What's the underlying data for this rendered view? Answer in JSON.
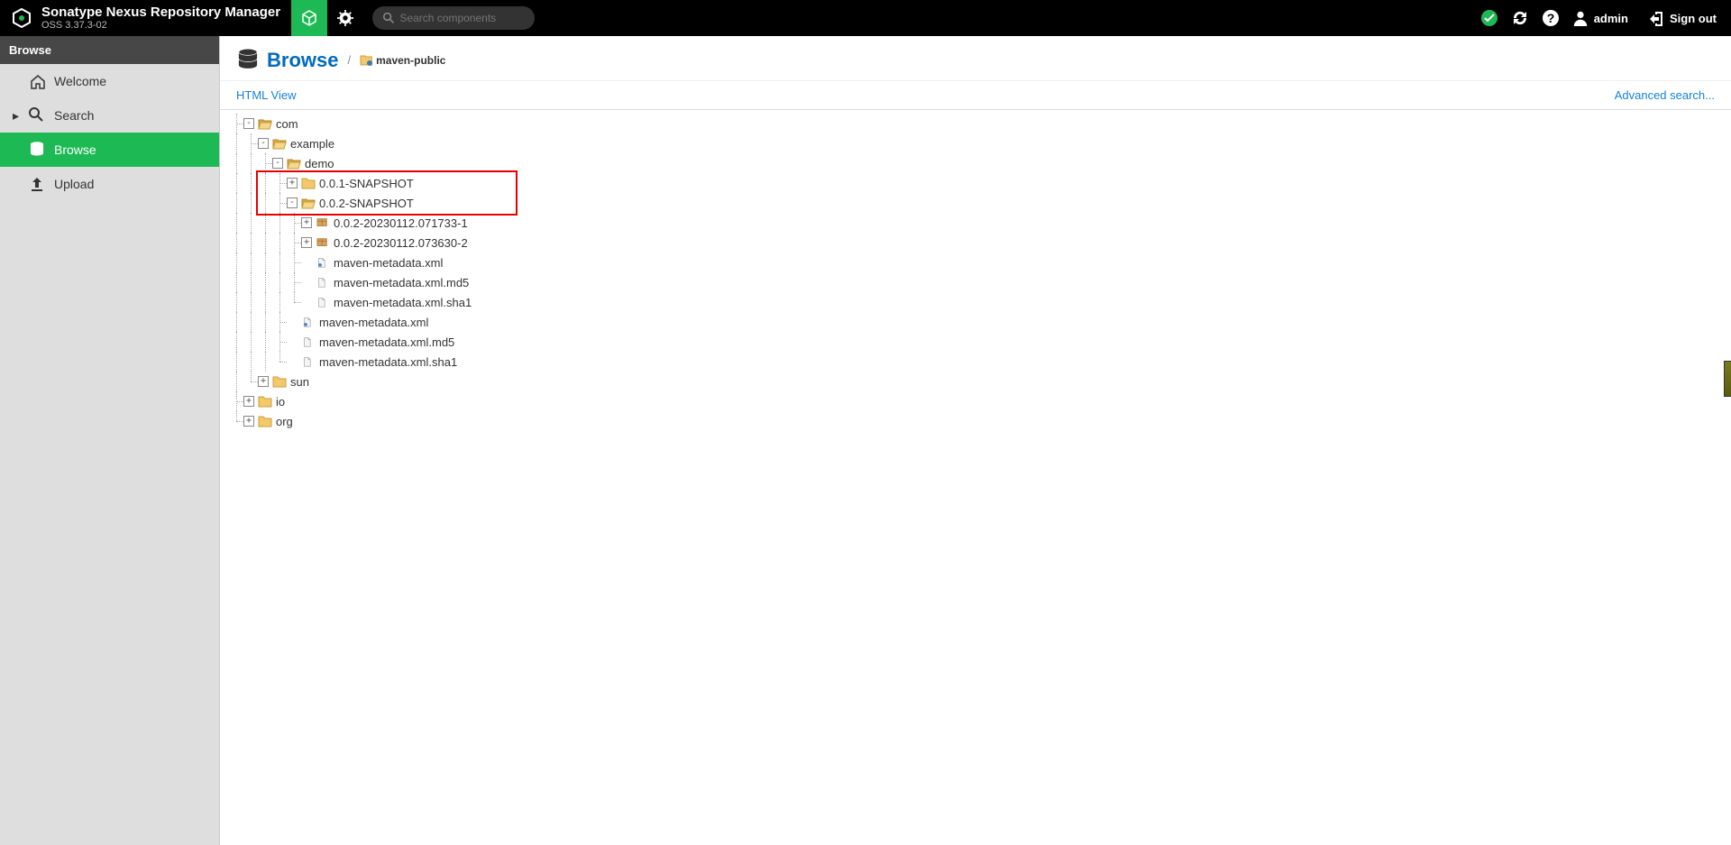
{
  "header": {
    "product_title": "Sonatype Nexus Repository Manager",
    "product_subtitle": "OSS 3.37.3-02",
    "search_placeholder": "Search components",
    "admin_label": "admin",
    "signout_label": "Sign out"
  },
  "sidebar": {
    "section_title": "Browse",
    "items": [
      {
        "label": "Welcome",
        "icon": "home"
      },
      {
        "label": "Search",
        "icon": "search",
        "caret": true
      },
      {
        "label": "Browse",
        "icon": "database",
        "active": true
      },
      {
        "label": "Upload",
        "icon": "upload"
      }
    ]
  },
  "page": {
    "title": "Browse",
    "breadcrumb_repo": "maven-public",
    "html_view_label": "HTML View",
    "advanced_search_label": "Advanced search..."
  },
  "tree": [
    {
      "depth": 0,
      "toggle": "-",
      "icon": "folder-open",
      "label": "com",
      "lastAt": []
    },
    {
      "depth": 1,
      "toggle": "-",
      "icon": "folder-open",
      "label": "example",
      "lastAt": []
    },
    {
      "depth": 2,
      "toggle": "-",
      "icon": "folder-open",
      "label": "demo",
      "lastAt": []
    },
    {
      "depth": 3,
      "toggle": "+",
      "icon": "folder-closed",
      "label": "0.0.1-SNAPSHOT",
      "lastAt": []
    },
    {
      "depth": 3,
      "toggle": "-",
      "icon": "folder-open",
      "label": "0.0.2-SNAPSHOT",
      "lastAt": []
    },
    {
      "depth": 4,
      "toggle": "+",
      "icon": "pkg",
      "label": "0.0.2-20230112.071733-1",
      "lastAt": []
    },
    {
      "depth": 4,
      "toggle": "+",
      "icon": "pkg",
      "label": "0.0.2-20230112.073630-2",
      "lastAt": []
    },
    {
      "depth": 4,
      "toggle": "",
      "icon": "file-xml",
      "label": "maven-metadata.xml",
      "lastAt": []
    },
    {
      "depth": 4,
      "toggle": "",
      "icon": "file",
      "label": "maven-metadata.xml.md5",
      "lastAt": []
    },
    {
      "depth": 4,
      "toggle": "",
      "icon": "file",
      "label": "maven-metadata.xml.sha1",
      "lastAt": [
        4,
        3
      ]
    },
    {
      "depth": 3,
      "toggle": "",
      "icon": "file-xml",
      "label": "maven-metadata.xml",
      "lastAt": []
    },
    {
      "depth": 3,
      "toggle": "",
      "icon": "file",
      "label": "maven-metadata.xml.md5",
      "lastAt": []
    },
    {
      "depth": 3,
      "toggle": "",
      "icon": "file",
      "label": "maven-metadata.xml.sha1",
      "lastAt": [
        3,
        2
      ]
    },
    {
      "depth": 1,
      "toggle": "+",
      "icon": "folder-closed",
      "label": "sun",
      "lastAt": [
        1
      ]
    },
    {
      "depth": 0,
      "toggle": "+",
      "icon": "folder-closed",
      "label": "io",
      "lastAt": []
    },
    {
      "depth": 0,
      "toggle": "+",
      "icon": "folder-closed",
      "label": "org",
      "lastAt": [
        0
      ]
    }
  ],
  "highlight": {
    "rows": [
      3,
      4
    ]
  }
}
